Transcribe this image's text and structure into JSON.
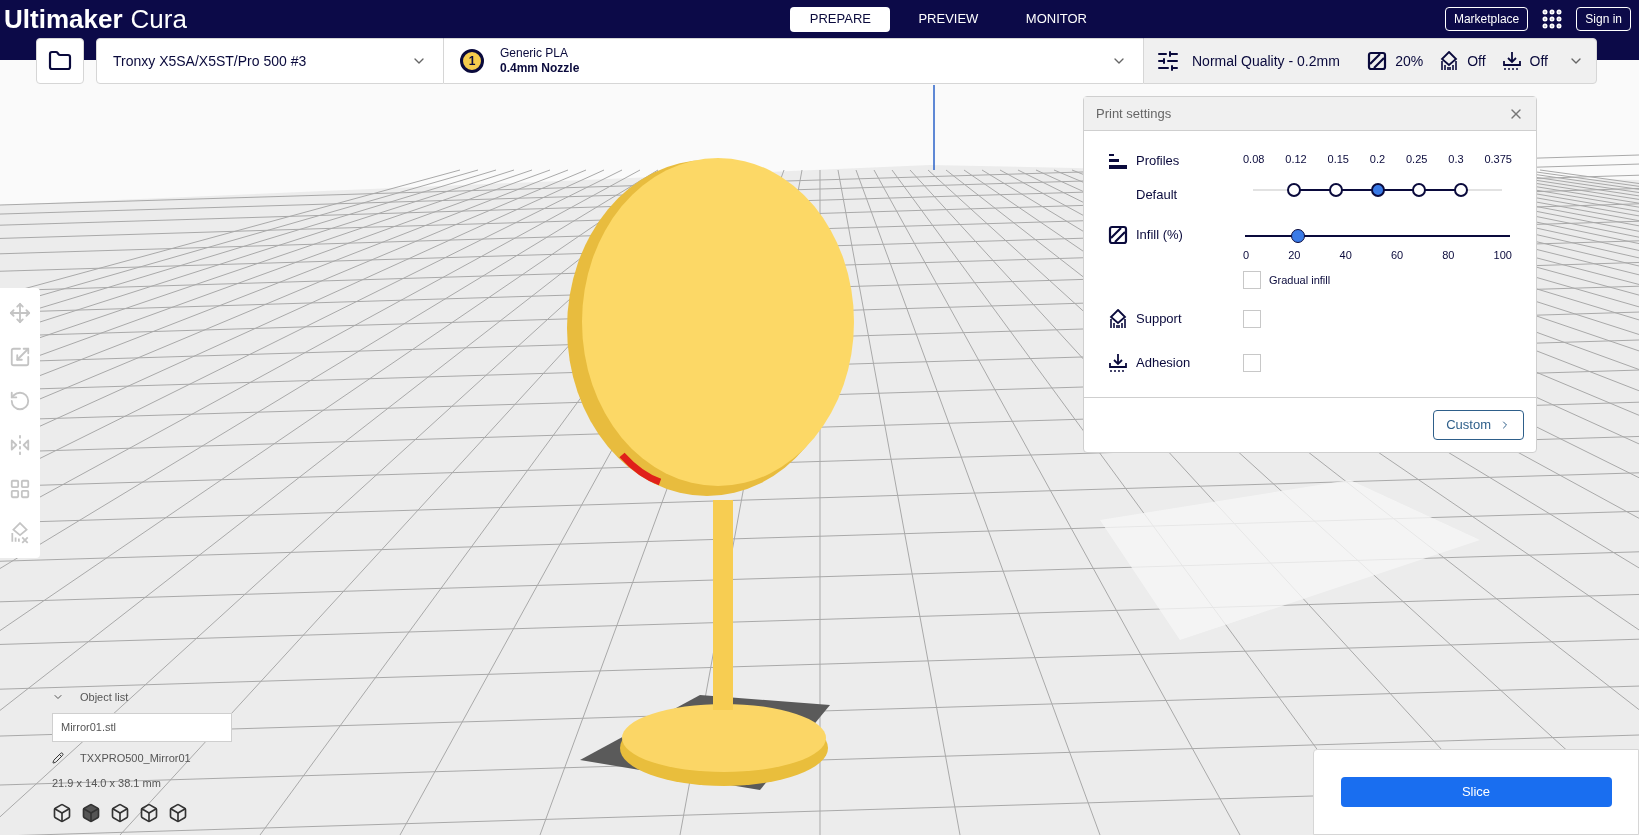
{
  "app": {
    "title_bold": "Ultimaker",
    "title_light": "Cura"
  },
  "stages": [
    {
      "label": "PREPARE",
      "selected": true
    },
    {
      "label": "PREVIEW",
      "selected": false
    },
    {
      "label": "MONITOR",
      "selected": false
    }
  ],
  "header_buttons": [
    "Marketplace",
    "Sign in"
  ],
  "printer": {
    "name": "Tronxy X5SA/X5ST/Pro 500 #3"
  },
  "material": {
    "extruder": "1",
    "name": "Generic PLA",
    "nozzle": "0.4mm Nozzle"
  },
  "summary": {
    "quality": "Normal Quality - 0.2mm",
    "infill": "20%",
    "support": "Off",
    "adhesion": "Off"
  },
  "tools": [
    {
      "kind": "move",
      "disabled": true
    },
    {
      "kind": "scale",
      "disabled": true
    },
    {
      "kind": "rotate",
      "disabled": true
    },
    {
      "kind": "mirror",
      "disabled": true
    },
    {
      "kind": "per_model",
      "disabled": true
    },
    {
      "kind": "blocker",
      "disabled": true
    }
  ],
  "print_settings": {
    "title": "Print settings",
    "profiles_label": "Profiles",
    "profile_name": "Default",
    "layer_heights": [
      "0.08",
      "0.12",
      "0.15",
      "0.2",
      "0.25",
      "0.3",
      "0.375"
    ],
    "profile_nodes": [
      {
        "selected": false
      },
      {
        "selected": false
      },
      {
        "selected": true
      },
      {
        "selected": false
      },
      {
        "selected": false
      }
    ],
    "infill_label": "Infill (%)",
    "infill": {
      "level": 0.2
    },
    "infill_ticks": [
      "0",
      "20",
      "40",
      "60",
      "80",
      "100"
    ],
    "gradual": {
      "label": "Gradual infill",
      "checked": false
    },
    "support": {
      "label": "Support",
      "checked": false
    },
    "adhesion": {
      "label": "Adhesion",
      "checked": false
    },
    "custom_button": "Custom"
  },
  "object_list": {
    "title": "Object list",
    "expanded": true,
    "file": "Mirror01.stl",
    "job_name": "TXXPRO500_Mirror01",
    "dimensions": "21.9 x 14.0 x 38.1 mm"
  },
  "view_buttons": [
    {
      "kind": "perspective"
    },
    {
      "kind": "front"
    },
    {
      "kind": "top"
    },
    {
      "kind": "left"
    },
    {
      "kind": "right"
    }
  ],
  "slice_button": "Slice"
}
